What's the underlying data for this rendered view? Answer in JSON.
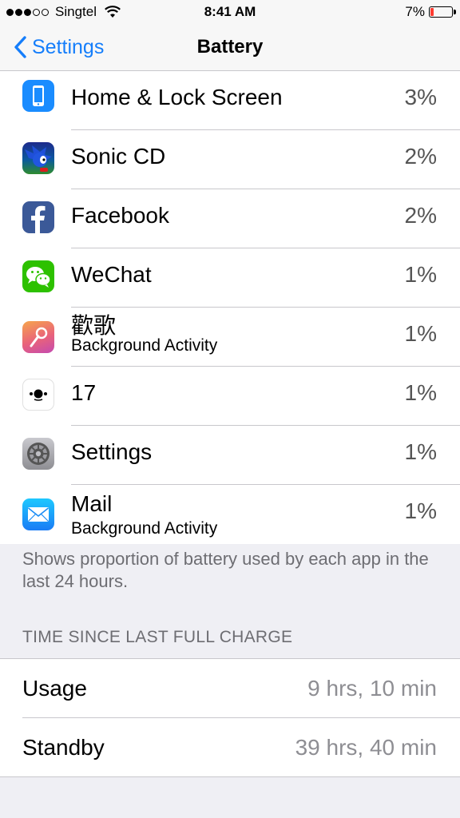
{
  "status_bar": {
    "carrier": "Singtel",
    "time": "8:41 AM",
    "battery": "7%",
    "signal_bars": 3,
    "signal_total": 5
  },
  "nav": {
    "back_label": "Settings",
    "title": "Battery"
  },
  "apps": [
    {
      "name": "Home & Lock Screen",
      "sub": "",
      "percent": "3%",
      "icon": "home-lock-screen-icon"
    },
    {
      "name": "Sonic CD",
      "sub": "",
      "percent": "2%",
      "icon": "sonic-cd-icon"
    },
    {
      "name": "Facebook",
      "sub": "",
      "percent": "2%",
      "icon": "facebook-icon"
    },
    {
      "name": "WeChat",
      "sub": "",
      "percent": "1%",
      "icon": "wechat-icon"
    },
    {
      "name": "歡歌",
      "sub": "Background Activity",
      "percent": "1%",
      "icon": "huange-icon"
    },
    {
      "name": "17",
      "sub": "",
      "percent": "1%",
      "icon": "app-17-icon"
    },
    {
      "name": "Settings",
      "sub": "",
      "percent": "1%",
      "icon": "settings-gear-icon"
    },
    {
      "name": "Mail",
      "sub": "Background Activity",
      "percent": "1%",
      "icon": "mail-icon"
    }
  ],
  "footer_note": "Shows proportion of battery used by each app in the last 24 hours.",
  "section_header": "TIME SINCE LAST FULL CHARGE",
  "stats": {
    "usage_label": "Usage",
    "usage_value": "9 hrs, 10 min",
    "standby_label": "Standby",
    "standby_value": "39 hrs, 40 min"
  },
  "colors": {
    "accent": "#157efb",
    "battery_low": "#ff3b30",
    "background": "#efeff4"
  }
}
